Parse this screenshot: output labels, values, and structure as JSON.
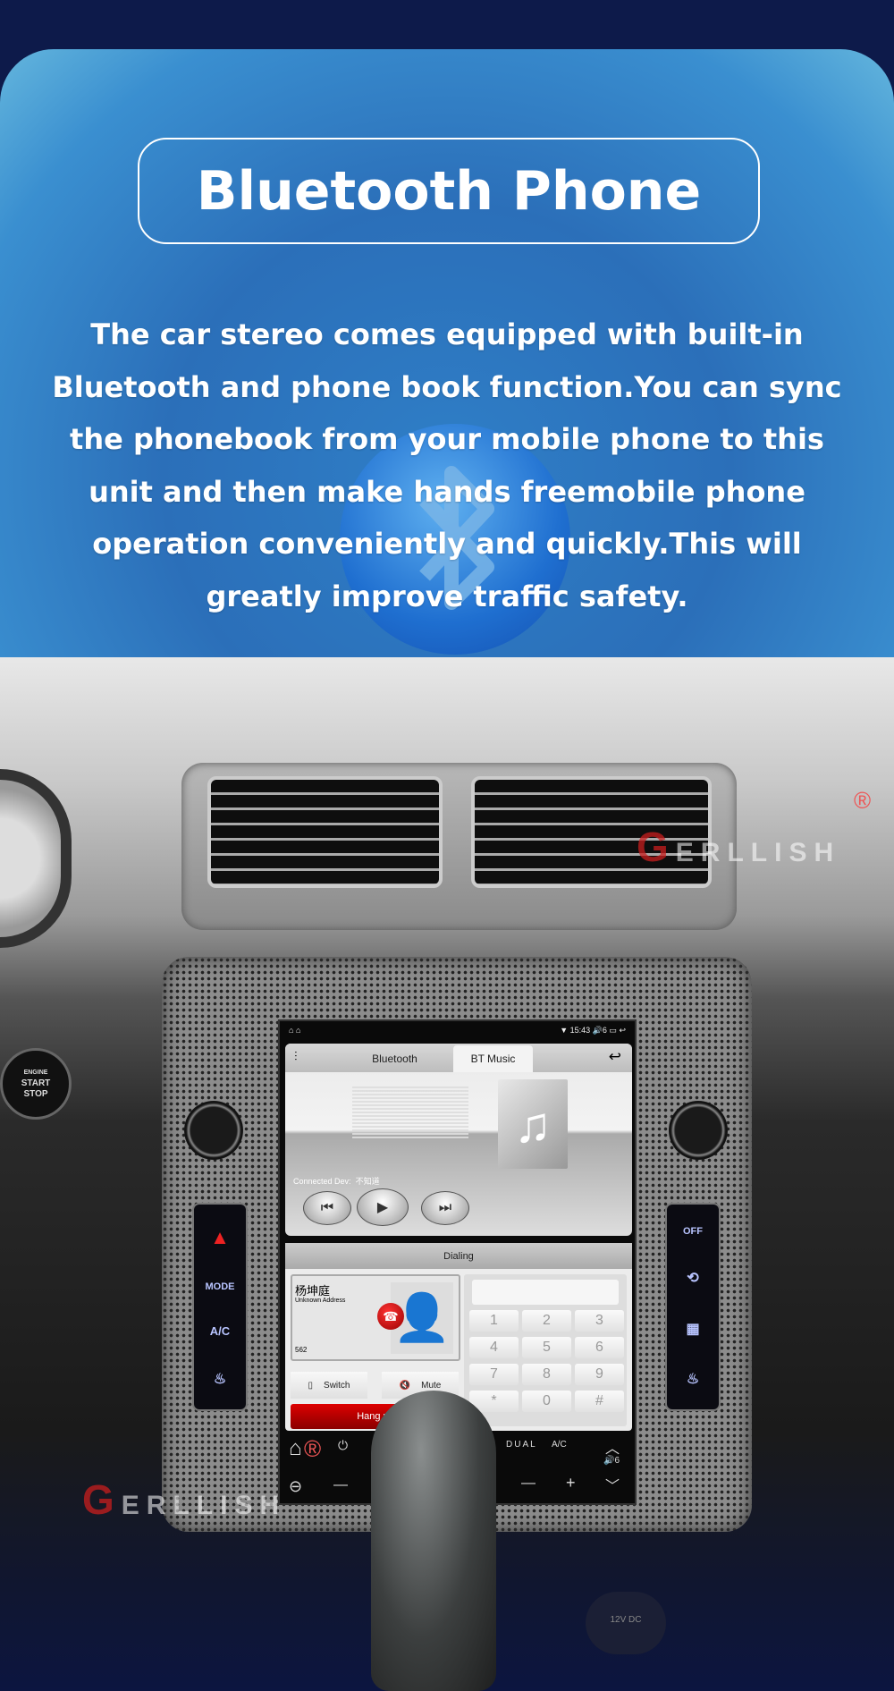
{
  "header": {
    "title": "Bluetooth Phone",
    "description": "The car stereo comes equipped with built-in Bluetooth and phone book function.You can sync the phonebook from your mobile phone to this unit and then make hands freemobile phone operation conveniently and quickly.This will greatly improve traffic safety."
  },
  "brand": {
    "watermark": "GERLLISH",
    "accent": "#c81e1e"
  },
  "car": {
    "start_button": [
      "ENGINE",
      "START",
      "STOP"
    ],
    "left_strip": [
      "MODE",
      "A/C"
    ],
    "right_strip": [
      "OFF"
    ],
    "usb_label": "12V DC"
  },
  "screen": {
    "status": {
      "time": "15:43",
      "volume": "6"
    },
    "tabs": [
      {
        "label": "Bluetooth"
      },
      {
        "label": "BT Music",
        "active": true
      }
    ],
    "connected_label": "Connected Dev:",
    "connected_value": "不知道",
    "dialing": {
      "title": "Dialing",
      "contact_name": "杨坤庭",
      "contact_address": "Unknown Address",
      "number": "562",
      "switch_label": "Switch",
      "mute_label": "Mute",
      "hangup_label": "Hang up",
      "keys": [
        "1",
        "2",
        "3",
        "4",
        "5",
        "6",
        "7",
        "8",
        "9",
        "*",
        "0",
        "#"
      ]
    },
    "climate": {
      "dual": "DUAL",
      "ac": "A/C",
      "volume": "6"
    }
  }
}
